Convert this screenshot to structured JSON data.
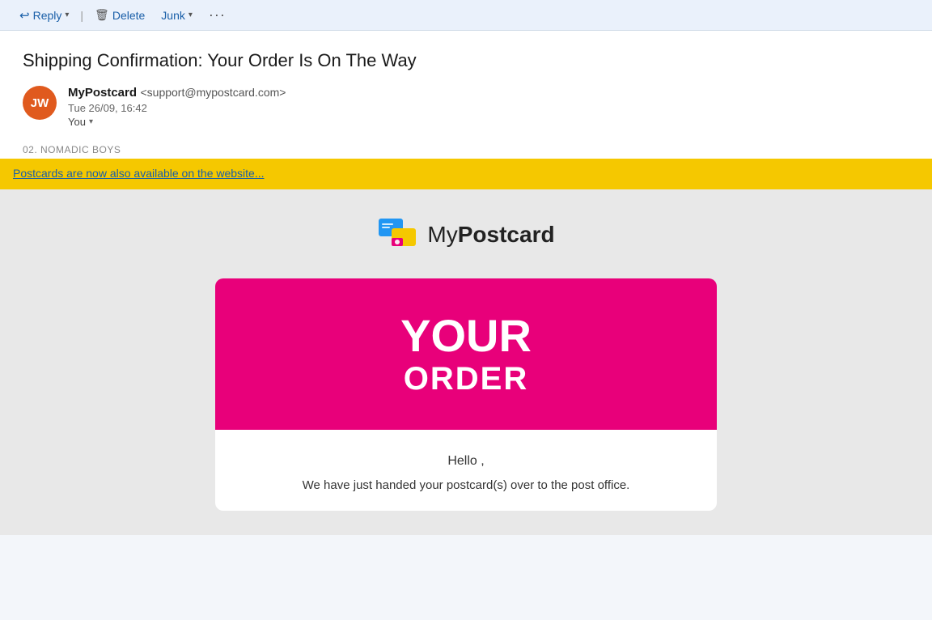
{
  "toolbar": {
    "reply_label": "Reply",
    "reply_dropdown_icon": "▾",
    "delete_label": "Delete",
    "junk_label": "Junk",
    "junk_dropdown_icon": "▾",
    "more_label": "···"
  },
  "email": {
    "subject": "Shipping Confirmation: Your Order Is On The Way",
    "sender_initials": "JW",
    "sender_name": "MyPostcard",
    "sender_email": "<support@mypostcard.com>",
    "sent_date": "Tue 26/09, 16:42",
    "recipient": "You",
    "category": "02. NOMADIC BOYS",
    "promo_text": "Postcards are now also available on the website...",
    "brand_name_regular": "My",
    "brand_name_bold": "Postcard",
    "order_banner_line1": "YOUR",
    "order_banner_line2": "ORDER",
    "hello_greeting": "Hello ,",
    "body_text": "We have just handed your postcard(s) over to the post office."
  },
  "colors": {
    "avatar_bg": "#e05a1e",
    "promo_banner_bg": "#f5c800",
    "order_banner_bg": "#e8007a",
    "brand_accent": "#1a5fa8"
  }
}
